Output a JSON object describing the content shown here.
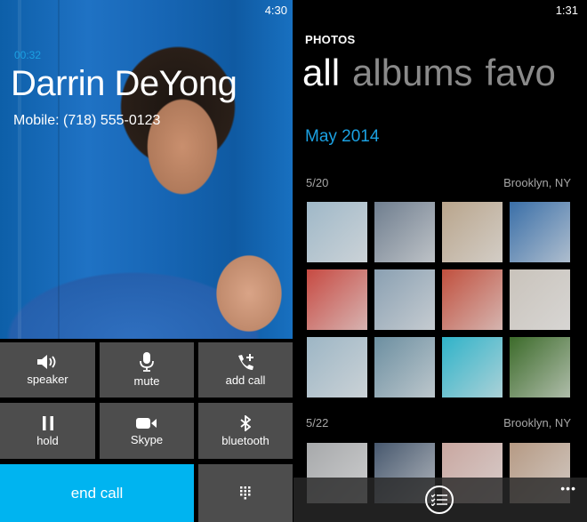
{
  "call_screen": {
    "status_time": "4:30",
    "call_duration": "00:32",
    "caller_name": "Darrin DeYong",
    "caller_number": "Mobile: (718) 555-0123",
    "accent_color": "#1ba1e2",
    "end_call_color": "#00b4f0",
    "buttons": [
      {
        "label": "speaker",
        "icon": "speaker-icon"
      },
      {
        "label": "mute",
        "icon": "microphone-icon"
      },
      {
        "label": "add call",
        "icon": "add-call-icon"
      },
      {
        "label": "hold",
        "icon": "pause-icon"
      },
      {
        "label": "Skype",
        "icon": "video-camera-icon"
      },
      {
        "label": "bluetooth",
        "icon": "bluetooth-icon"
      }
    ],
    "end_call_label": "end call",
    "keypad_icon": "keypad-icon"
  },
  "photos_screen": {
    "status_time": "1:31",
    "app_title": "PHOTOS",
    "pivot_tabs": [
      {
        "label": "all",
        "active": true
      },
      {
        "label": "albums",
        "active": false
      },
      {
        "label": "favo",
        "active": false
      }
    ],
    "month_header": "May 2014",
    "groups": [
      {
        "date": "5/20",
        "location": "Brooklyn, NY",
        "thumbnails": [
          "#9fb8c8",
          "#6f7e8f",
          "#b9a58c",
          "#3a6fa8",
          "#c74a42",
          "#8aa0b2",
          "#c1503e",
          "#c9c3bb",
          "#9db6c5",
          "#6c8fa1",
          "#2fb3c9",
          "#3c6b2a"
        ]
      },
      {
        "date": "5/22",
        "location": "Brooklyn, NY",
        "thumbnails": [
          "#a7a9ab",
          "#47586e",
          "#c9a7a0",
          "#b69a84"
        ]
      }
    ],
    "app_bar": {
      "select_icon": "multi-select-icon",
      "more_label": "•••"
    }
  }
}
